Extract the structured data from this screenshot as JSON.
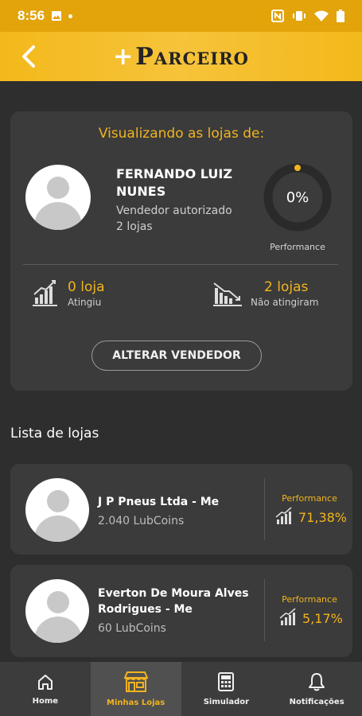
{
  "status_bar": {
    "time": "8:56"
  },
  "app_bar": {
    "logo_plus": "+",
    "logo_text": "Parceiro"
  },
  "summary": {
    "heading": "Visualizando as lojas de:",
    "seller_name": "FERNANDO LUIZ NUNES",
    "seller_role": "Vendedor autorizado",
    "seller_stores": "2 lojas",
    "performance_value": "0%",
    "performance_fraction": 0,
    "performance_label": "Performance",
    "reached_value": "0 loja",
    "reached_label": "Atingiu",
    "not_reached_value": "2 lojas",
    "not_reached_label": "Não atingiram",
    "alter_button": "ALTERAR VENDEDOR"
  },
  "stores_section": {
    "title": "Lista de lojas",
    "items": [
      {
        "name": "J P Pneus Ltda - Me",
        "coins": "2.040 LubCoins",
        "performance_label": "Performance",
        "performance": "71,38%"
      },
      {
        "name": "Everton De Moura Alves Rodrigues - Me",
        "coins": "60 LubCoins",
        "performance_label": "Performance",
        "performance": "5,17%"
      }
    ]
  },
  "bottom_nav": {
    "items": [
      {
        "label": "Home",
        "icon": "home-icon"
      },
      {
        "label": "Minhas Lojas",
        "icon": "store-icon",
        "active": true
      },
      {
        "label": "Simulador",
        "icon": "calculator-icon"
      },
      {
        "label": "Notificações",
        "icon": "bell-icon"
      }
    ]
  },
  "colors": {
    "accent": "#f2b41e",
    "app_bar": "#f3b91b",
    "background": "#2e2e2e",
    "card": "#3b3b3b"
  }
}
